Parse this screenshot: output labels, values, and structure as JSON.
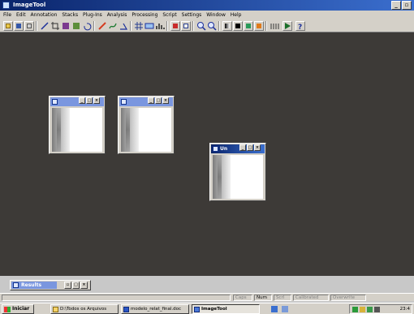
{
  "app": {
    "title": "ImageTool"
  },
  "menu": [
    "File",
    "Edit",
    "Annotation",
    "Stacks",
    "Plug-Ins",
    "Analysis",
    "Processing",
    "Script",
    "Settings",
    "Window",
    "Help"
  ],
  "toolbar": {
    "icons": [
      "open-icon",
      "save-icon",
      "print-icon",
      "line-icon",
      "crop-icon",
      "copy-icon",
      "paste-icon",
      "pencil-icon",
      "freehand-icon",
      "angle-icon",
      "grid-icon",
      "measure-icon",
      "histogram-icon",
      "image-icon",
      "zoom-in-icon",
      "zoom-out-icon",
      "lut-icon",
      "color-icon",
      "paint-icon",
      "stack-icon",
      "play-icon",
      "help-icon"
    ]
  },
  "windows": [
    {
      "title": "",
      "active": false
    },
    {
      "title": "",
      "active": false
    },
    {
      "title": "Un",
      "active": true
    }
  ],
  "results": {
    "title": "Results"
  },
  "statusbar": {
    "panels": [
      {
        "label": "Caps",
        "on": false
      },
      {
        "label": "Num",
        "on": true
      },
      {
        "label": "Scrl",
        "on": false
      },
      {
        "label": "Calibrated",
        "on": false
      },
      {
        "label": "Overwrite",
        "on": false
      }
    ]
  },
  "taskbar": {
    "start_label": "Iniciar",
    "tasks": [
      {
        "label": "D:\\Todos os Arquivos",
        "pressed": false
      },
      {
        "label": "modelo_relat_final.doc",
        "pressed": false
      },
      {
        "label": "ImageTool",
        "pressed": true
      }
    ],
    "clock": "23:4"
  },
  "colors": {
    "titlebar": "#0a246a",
    "workspace": "#3d3a37",
    "face": "#d4d0c8"
  }
}
